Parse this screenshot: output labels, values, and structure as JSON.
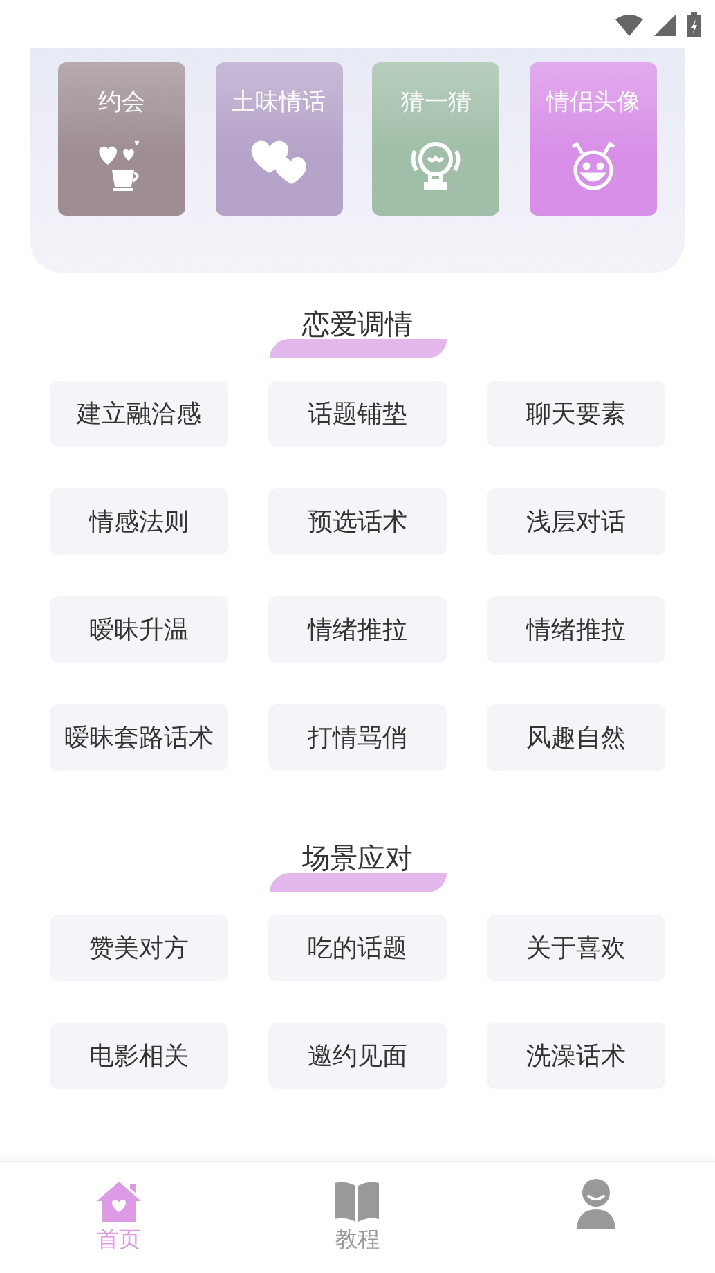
{
  "tiles": [
    {
      "label": "约会",
      "kind": "cup-hearts",
      "color": "#9e8e94"
    },
    {
      "label": "土味情话",
      "kind": "hearts",
      "color": "#b5a3c9"
    },
    {
      "label": "猜一猜",
      "kind": "robot",
      "color": "#a0bea8"
    },
    {
      "label": "情侣头像",
      "kind": "smiley",
      "color": "#d88fe8"
    }
  ],
  "sections": [
    {
      "title": "恋爱调情",
      "items": [
        "建立融洽感",
        "话题铺垫",
        "聊天要素",
        "情感法则",
        "预选话术",
        "浅层对话",
        "暧昧升温",
        "情绪推拉",
        "情绪推拉",
        "暧昧套路话术",
        "打情骂俏",
        "风趣自然"
      ]
    },
    {
      "title": "场景应对",
      "items": [
        "赞美对方",
        "吃的话题",
        "关于喜欢",
        "电影相关",
        "邀约见面",
        "洗澡话术"
      ]
    }
  ],
  "nav": [
    {
      "label": "首页",
      "kind": "home",
      "selected": true
    },
    {
      "label": "教程",
      "kind": "book",
      "selected": false
    },
    {
      "kind": "person",
      "selected": false
    }
  ]
}
